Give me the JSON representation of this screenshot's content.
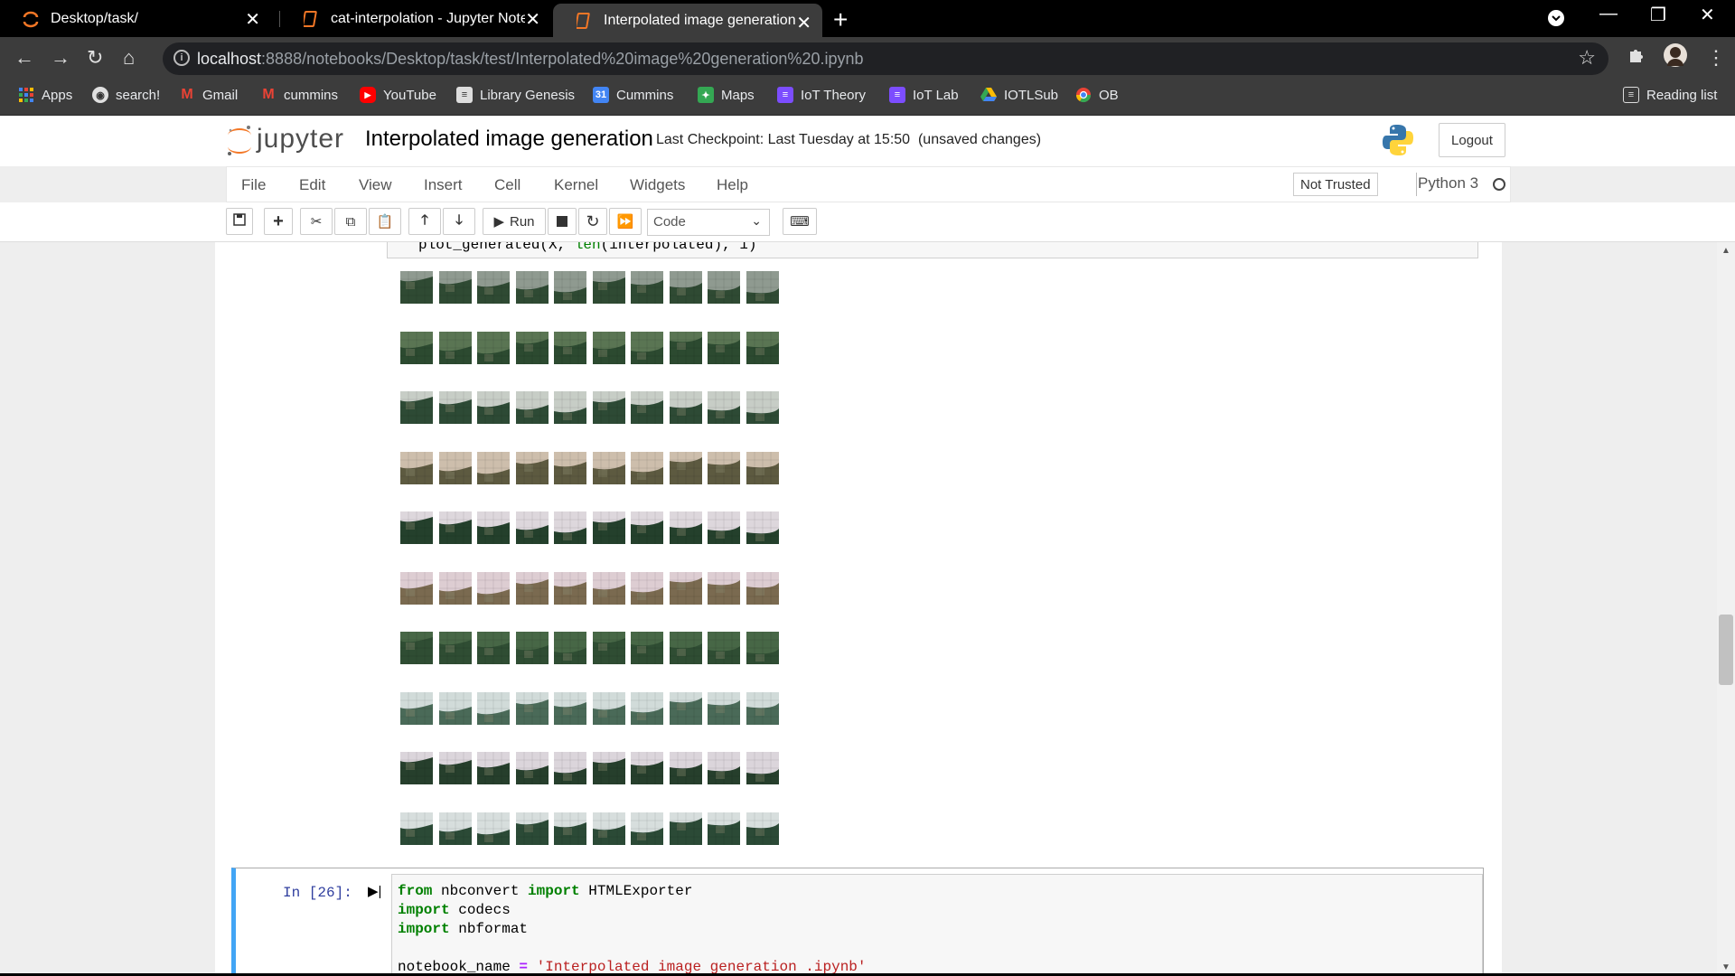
{
  "browser": {
    "tabs": [
      {
        "label": "Desktop/task/",
        "icon": "jupyter-icon"
      },
      {
        "label": "cat-interpolation - Jupyter Notebook",
        "icon": "notebook-icon"
      },
      {
        "label": "Interpolated image generation - Jupyter Notebook",
        "icon": "notebook-icon"
      }
    ],
    "active_tab": 2,
    "url_host": "localhost",
    "url_rest": ":8888/notebooks/Desktop/task/test/Interpolated%20image%20generation%20.ipynb",
    "bookmarks": [
      {
        "label": "Apps",
        "icon": "apps-grid-icon"
      },
      {
        "label": "search!",
        "icon": "globe-icon"
      },
      {
        "label": "Gmail",
        "icon": "gmail-icon"
      },
      {
        "label": "cummins",
        "icon": "gmail-icon"
      },
      {
        "label": "YouTube",
        "icon": "youtube-icon"
      },
      {
        "label": "Library Genesis",
        "icon": "book-icon"
      },
      {
        "label": "Cummins",
        "icon": "calendar-icon"
      },
      {
        "label": "Maps",
        "icon": "maps-icon"
      },
      {
        "label": "IoT Theory",
        "icon": "classroom-icon"
      },
      {
        "label": "IoT Lab",
        "icon": "classroom-icon"
      },
      {
        "label": "IOTLSub",
        "icon": "drive-icon"
      },
      {
        "label": "OB",
        "icon": "chrome-icon"
      }
    ],
    "reading_list": "Reading list"
  },
  "jupyter": {
    "logo_text": "jupyter",
    "notebook_title": "Interpolated image generation",
    "checkpoint": "Last Checkpoint: Last Tuesday at 15:50",
    "unsaved": "(unsaved changes)",
    "logout": "Logout",
    "menu": [
      "File",
      "Edit",
      "View",
      "Insert",
      "Cell",
      "Kernel",
      "Widgets",
      "Help"
    ],
    "trust": "Not Trusted",
    "kernel": "Python 3",
    "toolbar": {
      "run_label": "Run",
      "cell_type": "Code"
    }
  },
  "cells": {
    "prev_code_fragment": {
      "pre": "plot_generated(X, ",
      "fn": "len",
      "post": "(interpolated), 1)"
    },
    "output_grid": {
      "rows": 10,
      "cols": 10
    },
    "current": {
      "prompt": "In [26]:",
      "lines": [
        [
          {
            "t": "from",
            "c": "kw"
          },
          {
            "t": " nbconvert ",
            "c": ""
          },
          {
            "t": "import",
            "c": "kw"
          },
          {
            "t": " HTMLExporter",
            "c": ""
          }
        ],
        [
          {
            "t": "import",
            "c": "kw"
          },
          {
            "t": " codecs",
            "c": ""
          }
        ],
        [
          {
            "t": "import",
            "c": "kw"
          },
          {
            "t": " nbformat",
            "c": ""
          }
        ],
        [
          {
            "t": "",
            "c": ""
          }
        ],
        [
          {
            "t": "notebook_name ",
            "c": ""
          },
          {
            "t": "=",
            "c": "op"
          },
          {
            "t": " ",
            "c": ""
          },
          {
            "t": "'Interpolated image generation .ipynb'",
            "c": "str"
          }
        ]
      ]
    }
  },
  "colors": {
    "accent_blue": "#42a5f5",
    "chrome_dark": "#3c3c3c",
    "jupyter_orange": "#f37726"
  }
}
